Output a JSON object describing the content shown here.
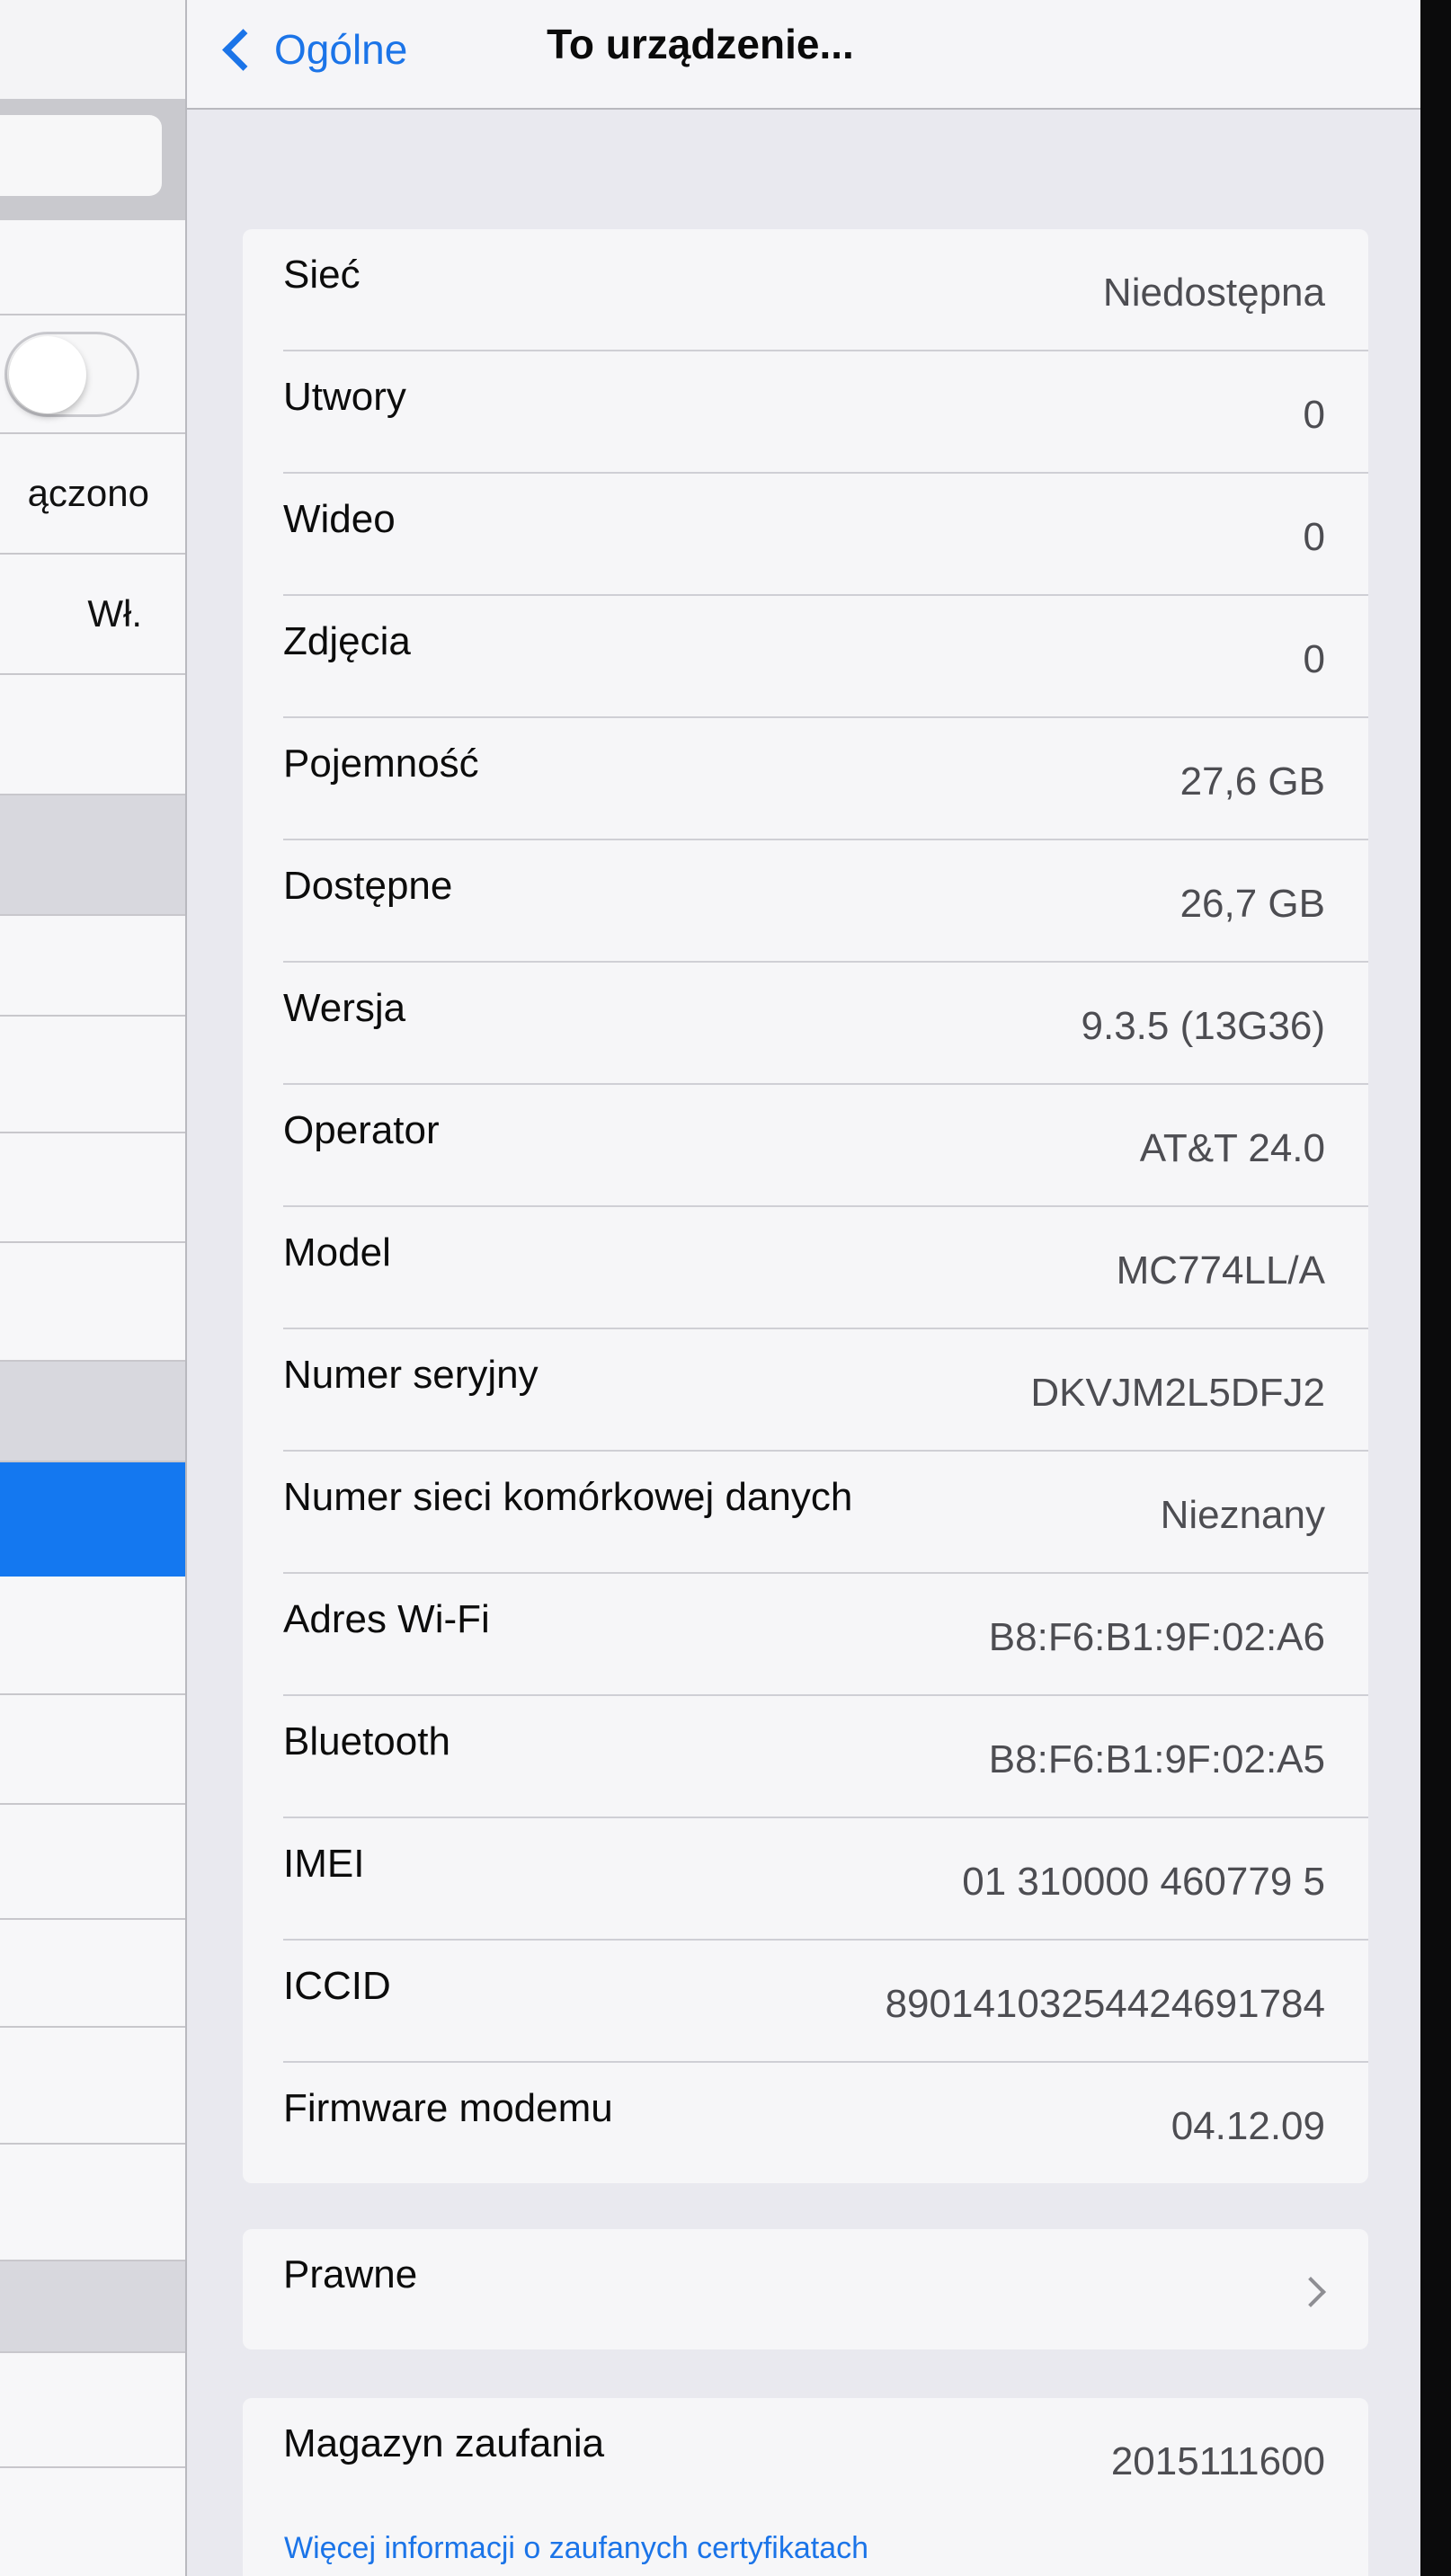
{
  "navbar": {
    "back_label": "Ogólne",
    "title": "To urządzenie..."
  },
  "master": {
    "row_texts": [
      "ączono",
      "Wł."
    ]
  },
  "info_rows": [
    {
      "label": "Sieć",
      "value": "Niedostępna"
    },
    {
      "label": "Utwory",
      "value": "0"
    },
    {
      "label": "Wideo",
      "value": "0"
    },
    {
      "label": "Zdjęcia",
      "value": "0"
    },
    {
      "label": "Pojemność",
      "value": "27,6 GB"
    },
    {
      "label": "Dostępne",
      "value": "26,7 GB"
    },
    {
      "label": "Wersja",
      "value": "9.3.5 (13G36)"
    },
    {
      "label": "Operator",
      "value": "AT&T 24.0"
    },
    {
      "label": "Model",
      "value": "MC774LL/A"
    },
    {
      "label": "Numer seryjny",
      "value": "DKVJM2L5DFJ2"
    },
    {
      "label": "Numer sieci komórkowej danych",
      "value": "Nieznany"
    },
    {
      "label": "Adres Wi-Fi",
      "value": "B8:F6:B1:9F:02:A6"
    },
    {
      "label": "Bluetooth",
      "value": "B8:F6:B1:9F:02:A5"
    },
    {
      "label": "IMEI",
      "value": "01 310000 460779 5"
    },
    {
      "label": "ICCID",
      "value": "89014103254424691784"
    },
    {
      "label": "Firmware modemu",
      "value": "04.12.09"
    }
  ],
  "legal": {
    "label": "Prawne"
  },
  "trust_store": {
    "label": "Magazyn zaufania",
    "value": "2015111600"
  },
  "footer": {
    "link": "Więcej informacji o zaufanych certyfikatach"
  },
  "colors": {
    "accent": "#1b74e8",
    "selected_row": "#1478f0"
  }
}
